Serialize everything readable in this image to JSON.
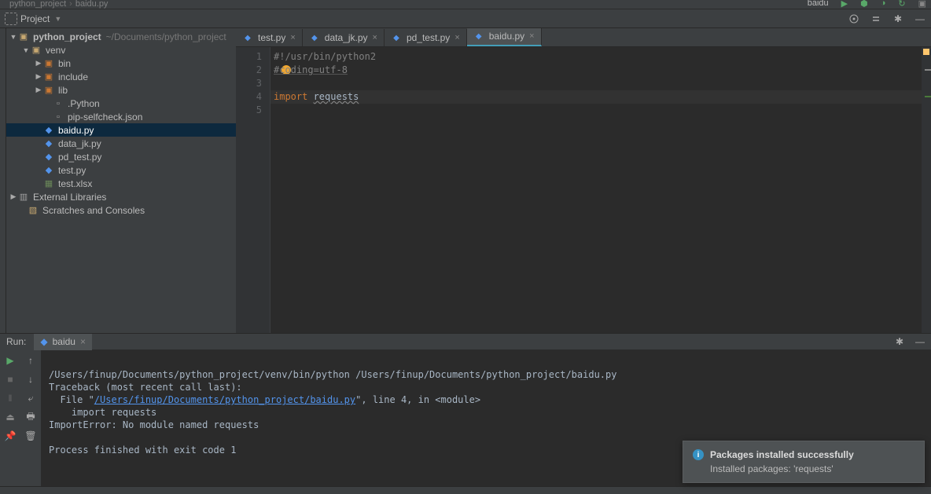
{
  "breadcrumbs": {
    "parent": "python_project",
    "file": "baidu.py",
    "run_config": "baidu"
  },
  "project_header": {
    "label": "Project"
  },
  "tree": {
    "root": {
      "name": "python_project",
      "path": "~/Documents/python_project"
    },
    "venv": "venv",
    "bin": "bin",
    "include": "include",
    "lib": "lib",
    "python_file": ".Python",
    "pip_self": "pip-selfcheck.json",
    "baidu": "baidu.py",
    "data_jk": "data_jk.py",
    "pd_test": "pd_test.py",
    "test_py": "test.py",
    "test_xlsx": "test.xlsx",
    "ext_libs": "External Libraries",
    "scratches": "Scratches and Consoles"
  },
  "tabs": [
    {
      "label": "test.py"
    },
    {
      "label": "data_jk.py"
    },
    {
      "label": "pd_test.py"
    },
    {
      "label": "baidu.py"
    }
  ],
  "code": {
    "line1": "#!/usr/bin/python2",
    "line2": "#coding=utf-8",
    "line4_kw": "import ",
    "line4_id": "requests"
  },
  "gutter_lines": [
    "1",
    "2",
    "3",
    "4",
    "5"
  ],
  "run": {
    "label": "Run:",
    "tab": "baidu",
    "cmd": "/Users/finup/Documents/python_project/venv/bin/python /Users/finup/Documents/python_project/baidu.py",
    "trace1": "Traceback (most recent call last):",
    "trace2_a": "  File \"",
    "trace2_link": "/Users/finup/Documents/python_project/baidu.py",
    "trace2_b": "\", line 4, in <module>",
    "trace3": "    import requests",
    "trace4": "ImportError: No module named requests",
    "exit": "Process finished with exit code 1"
  },
  "notif": {
    "title": "Packages installed successfully",
    "body": "Installed packages: 'requests'"
  }
}
